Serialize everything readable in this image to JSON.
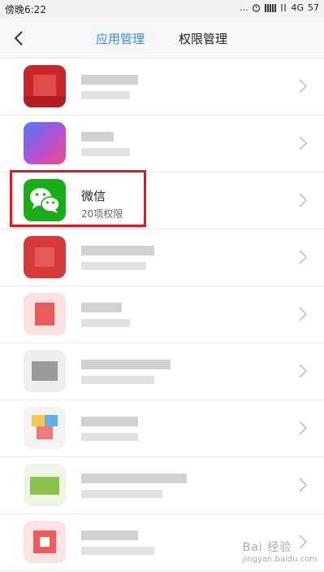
{
  "status_bar": {
    "time": "傍晚6:22",
    "dots": "...",
    "network": "4G",
    "battery": "57"
  },
  "header": {
    "tab_active": "应用管理",
    "tab_inactive": "权限管理"
  },
  "apps": [
    {
      "name": "",
      "sub": "",
      "icon_colors": [
        "#c9262b",
        "#e04b4b",
        "#b31e23"
      ]
    },
    {
      "name": "",
      "sub": "",
      "icon_colors": [
        "#4f7cf7",
        "#b84fd4",
        "#f04f7a"
      ]
    },
    {
      "name": "微信",
      "sub": "20项权限",
      "icon_colors": [
        "#1aad19"
      ]
    },
    {
      "name": "",
      "sub": "",
      "icon_colors": [
        "#d73a3a",
        "#e55a5a"
      ]
    },
    {
      "name": "",
      "sub": "",
      "icon_colors": [
        "#f08080",
        "#e95a5a"
      ]
    },
    {
      "name": "",
      "sub": "",
      "icon_colors": [
        "#9a9a9a",
        "#d0d0d0"
      ]
    },
    {
      "name": "",
      "sub": "",
      "icon_colors": [
        "#f6c94a",
        "#5fb0ef",
        "#f07a7a"
      ]
    },
    {
      "name": "",
      "sub": "",
      "icon_colors": [
        "#8bc34a",
        "#a6d36a"
      ]
    },
    {
      "name": "",
      "sub": "",
      "icon_colors": [
        "#f15b5b",
        "#f79a9a"
      ]
    }
  ],
  "watermark": {
    "text": "Bai 经验",
    "url": "jingyan.baidu.com"
  }
}
